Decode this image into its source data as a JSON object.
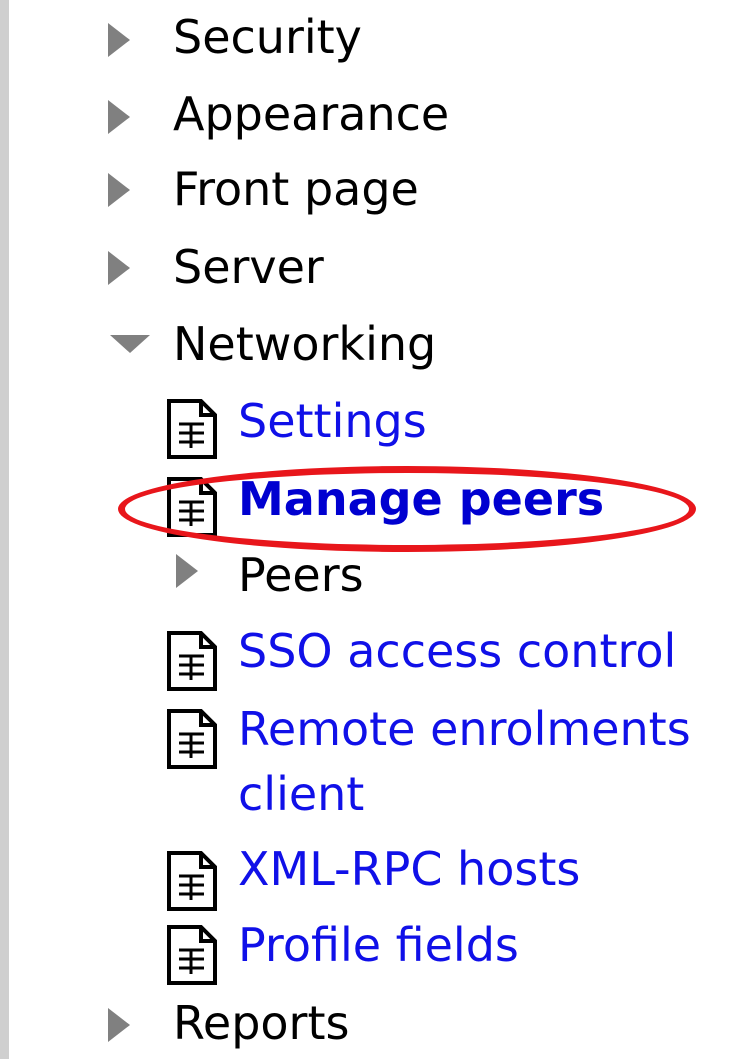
{
  "nav": {
    "items": [
      {
        "label": "Security"
      },
      {
        "label": "Appearance"
      },
      {
        "label": "Front page"
      },
      {
        "label": "Server"
      },
      {
        "label": "Networking"
      }
    ],
    "networking_children": [
      {
        "label": "Settings"
      },
      {
        "label": "Manage peers"
      },
      {
        "label": "Peers"
      },
      {
        "label": "SSO access control"
      },
      {
        "label": "Remote enrolments",
        "label2": "client"
      },
      {
        "label": "XML-RPC hosts"
      },
      {
        "label": "Profile fields"
      }
    ],
    "reports": {
      "label": "Reports"
    }
  },
  "colors": {
    "link": "#1010e8",
    "highlight_oval": "#e8161b",
    "arrow": "#808080"
  }
}
